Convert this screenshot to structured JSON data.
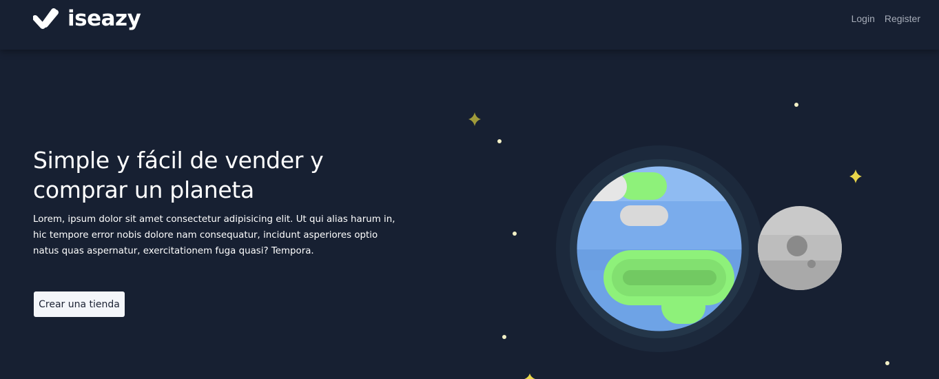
{
  "header": {
    "brand": "iseazy",
    "nav": {
      "login": "Login",
      "register": "Register"
    }
  },
  "hero": {
    "title": "Simple y fácil de vender y comprar un planeta",
    "description": "Lorem, ipsum dolor sit amet consectetur adipisicing elit. Ut qui alias harum in, hic tempore error nobis dolore nam consequatur, incidunt asperiores optio natus quas aspernatur, exercitationem fuga quasi? Tempora.",
    "cta_label": "Crear una tienda"
  },
  "illustration": {
    "icons": [
      "sparkle-star-icon",
      "dot-star-icon",
      "planet-illustration",
      "moon-illustration"
    ],
    "colors": {
      "background": "#172032",
      "halo_outer": "#1c293c",
      "halo_inner": "#243649",
      "ocean": "#6ea3e6",
      "land": "#8ef17a",
      "moon": "#c9c9c9",
      "star": "#e9d64a"
    }
  }
}
